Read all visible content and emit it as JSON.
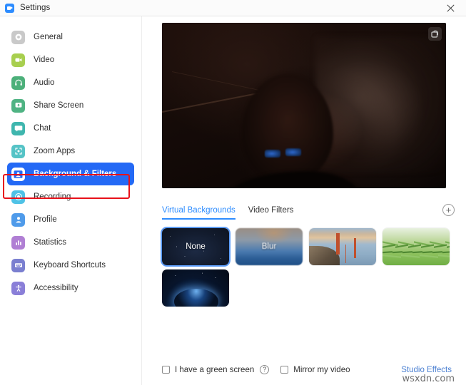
{
  "window": {
    "title": "Settings",
    "app_icon": "zoom-camera-icon",
    "close_label": "✕"
  },
  "sidebar": {
    "items": [
      {
        "label": "General",
        "icon": "gear-icon",
        "color": "#c9c9c9",
        "active": false
      },
      {
        "label": "Video",
        "icon": "camera-icon",
        "color": "#a8cf4f",
        "active": false
      },
      {
        "label": "Audio",
        "icon": "headphones-icon",
        "color": "#4cb07a",
        "active": false
      },
      {
        "label": "Share Screen",
        "icon": "upload-icon",
        "color": "#4fb383",
        "active": false
      },
      {
        "label": "Chat",
        "icon": "chat-icon",
        "color": "#3fb6ae",
        "active": false
      },
      {
        "label": "Zoom Apps",
        "icon": "apps-icon",
        "color": "#55c3c6",
        "active": false
      },
      {
        "label": "Background & Filters",
        "icon": "person-card-icon",
        "color": "#2469f5",
        "active": true
      },
      {
        "label": "Recording",
        "icon": "record-icon",
        "color": "#4fc2e6",
        "active": false
      },
      {
        "label": "Profile",
        "icon": "person-icon",
        "color": "#4f9bea",
        "active": false
      },
      {
        "label": "Statistics",
        "icon": "bar-chart-icon",
        "color": "#b07fd4",
        "active": false
      },
      {
        "label": "Keyboard Shortcuts",
        "icon": "keyboard-icon",
        "color": "#7a7fd0",
        "active": false
      },
      {
        "label": "Accessibility",
        "icon": "accessibility-icon",
        "color": "#8a7fd8",
        "active": false
      }
    ],
    "active_index": 6,
    "highlight_color": "#e8111a",
    "active_background": "#2469f5"
  },
  "main": {
    "preview": {
      "name": "video-preview",
      "badge_icon": "picture-in-picture-icon"
    },
    "tabs": [
      {
        "label": "Virtual Backgrounds",
        "active": true
      },
      {
        "label": "Video Filters",
        "active": false
      }
    ],
    "add_button_label": "+",
    "accent_color": "#2d8cff",
    "backgrounds": [
      {
        "label": "None",
        "kind": "none",
        "selected": true
      },
      {
        "label": "Blur",
        "kind": "blur",
        "selected": false
      },
      {
        "label": "",
        "kind": "bridge",
        "selected": false
      },
      {
        "label": "",
        "kind": "grass",
        "selected": false
      },
      {
        "label": "",
        "kind": "earth",
        "selected": false
      }
    ],
    "footer": {
      "green_screen_label": "I have a green screen",
      "green_screen_checked": false,
      "help_label": "?",
      "mirror_label": "Mirror my video",
      "mirror_checked": false,
      "studio_effects_label": "Studio Effects",
      "studio_effects_color": "#4a7fd1"
    }
  },
  "watermark": "wsxdn.com"
}
